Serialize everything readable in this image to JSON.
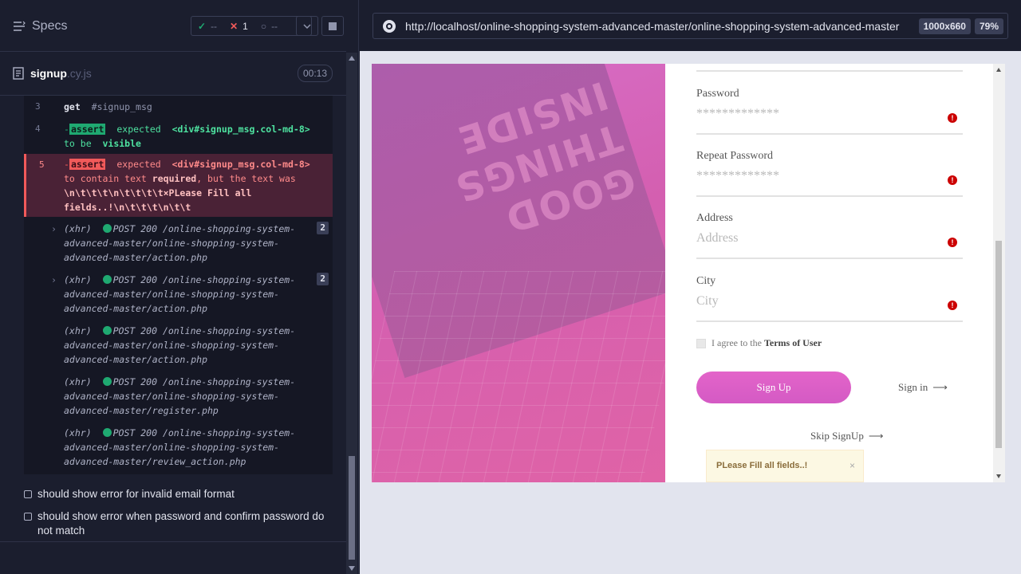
{
  "reporter": {
    "specs_label": "Specs",
    "stats": {
      "passed": "--",
      "failed": "1",
      "pending": "--"
    },
    "spec": {
      "name": "signup",
      "ext": ".cy.js",
      "time": "00:13"
    },
    "commands": [
      {
        "num": "3",
        "name": "get",
        "arg": "#signup_msg"
      },
      {
        "num": "4",
        "tag": "assert",
        "word": "expected",
        "subject": "<div#signup_msg.col-md-8>",
        "rest_a": "to be",
        "rest_b": "visible"
      },
      {
        "num": "5",
        "tag": "assert",
        "word": "expected",
        "subject": "<div#signup_msg.col-md-8>",
        "line2a": "to contain text",
        "line2b": "required",
        "line2c": ", but the text was",
        "line3": "\\n\\t\\t\\t\\n\\t\\t\\t\\t×PLease Fill all",
        "line4": "fields..!\\n\\t\\t\\t\\n\\t\\t"
      }
    ],
    "xhr": [
      {
        "label": "(xhr)",
        "method": "POST 200",
        "url": "/online-shopping-system-advanced-master/online-shopping-system-advanced-master/action.php",
        "count": "2"
      },
      {
        "label": "(xhr)",
        "method": "POST 200",
        "url": "/online-shopping-system-advanced-master/online-shopping-system-advanced-master/action.php",
        "count": "2"
      },
      {
        "label": "(xhr)",
        "method": "POST 200",
        "url": "/online-shopping-system-advanced-master/online-shopping-system-advanced-master/action.php"
      },
      {
        "label": "(xhr)",
        "method": "POST 200",
        "url": "/online-shopping-system-advanced-master/online-shopping-system-advanced-master/register.php"
      },
      {
        "label": "(xhr)",
        "method": "POST 200",
        "url": "/online-shopping-system-advanced-master/online-shopping-system-advanced-master/review_action.php"
      }
    ],
    "xhr_lines": [
      [
        "/online-shopping-system-",
        "advanced-master/online-shopping-system-",
        "advanced-master/action.php"
      ],
      [
        "/online-shopping-system-",
        "advanced-master/online-shopping-system-",
        "advanced-master/action.php"
      ],
      [
        "/online-shopping-system-",
        "advanced-master/online-shopping-system-",
        "advanced-master/action.php"
      ],
      [
        "/online-shopping-system-",
        "advanced-master/online-shopping-system-",
        "advanced-master/register.php"
      ],
      [
        "/online-shopping-system-",
        "advanced-master/online-shopping-system-",
        "advanced-master/review_action.php"
      ]
    ],
    "tests": [
      {
        "title": "should show error for invalid email format"
      },
      {
        "title": "should show error when password and confirm password do not match"
      }
    ]
  },
  "browser": {
    "url": "http://localhost/online-shopping-system-advanced-master/online-shopping-system-advanced-master",
    "viewport": "1000x660",
    "zoom": "79%"
  },
  "page": {
    "hero_text": [
      "GOOD",
      "THINGS",
      "INSIDE"
    ],
    "fields": [
      {
        "label": "Password",
        "value": "*************"
      },
      {
        "label": "Repeat Password",
        "value": "*************"
      },
      {
        "label": "Address",
        "value": "Address"
      },
      {
        "label": "City",
        "value": "City"
      }
    ],
    "terms_prefix": "I agree to the",
    "terms_link": "Terms of User",
    "signup_button": "Sign Up",
    "signin_link": "Sign in",
    "skip_link": "Skip SignUp",
    "alert_text": "PLease Fill all fields..!",
    "alert_close": "×",
    "arrow": "⟶"
  },
  "colors": {
    "pass": "#1fa971",
    "fail": "#f15a5a",
    "accent": "#d45ac4",
    "alert_bg": "#fcf8e3"
  }
}
